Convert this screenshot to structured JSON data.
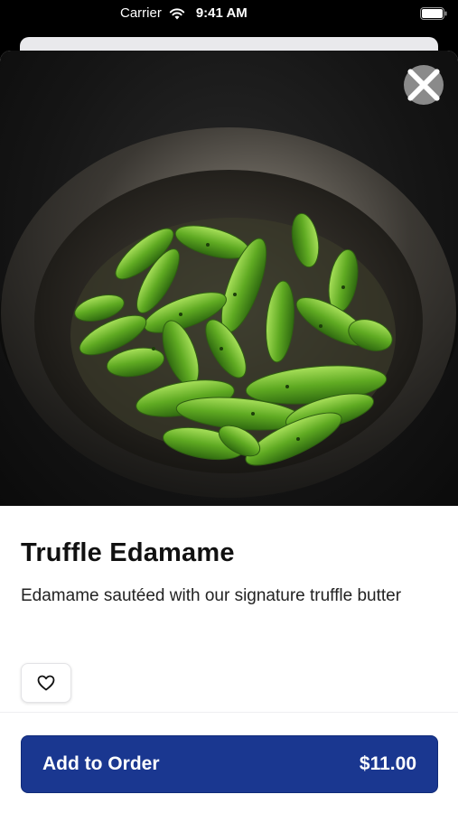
{
  "status_bar": {
    "carrier": "Carrier",
    "time": "9:41 AM",
    "wifi_icon": "wifi-icon",
    "battery_icon": "battery-icon"
  },
  "item": {
    "image_icon": "edamame-bowl-photo",
    "title": "Truffle Edamame",
    "description": "Edamame sautéed with our signature truffle butter"
  },
  "actions": {
    "close_icon": "close-icon",
    "favorite_icon": "heart-icon",
    "add_label": "Add to Order",
    "price": "$11.00"
  },
  "colors": {
    "accent": "#1a3790",
    "close_bg": "#a0a0a0"
  }
}
